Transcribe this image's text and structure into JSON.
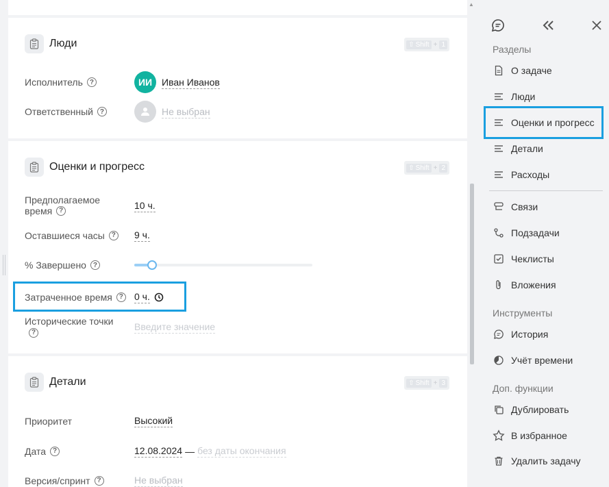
{
  "people": {
    "title": "Люди",
    "hotkey": {
      "shift": "Shift",
      "plus": "+",
      "num": "1"
    },
    "assignee_label": "Исполнитель",
    "assignee_initials": "ИИ",
    "assignee_name": "Иван Иванов",
    "responsible_label": "Ответственный",
    "responsible_value": "Не выбран"
  },
  "estimates": {
    "title": "Оценки и прогресс",
    "hotkey": {
      "shift": "Shift",
      "plus": "+",
      "num": "2"
    },
    "estimated_label_1": "Предполагаемое",
    "estimated_label_2": "время",
    "estimated_value": "10 ч.",
    "remaining_label": "Оставшиеся часы",
    "remaining_value": "9 ч.",
    "percent_label": "% Завершено",
    "percent_value": 0.1,
    "spent_label": "Затраченное время",
    "spent_value": "0 ч.",
    "historical_label": "Исторические точки",
    "historical_placeholder": "Введите значение"
  },
  "details": {
    "title": "Детали",
    "hotkey": {
      "shift": "Shift",
      "plus": "+",
      "num": "3"
    },
    "priority_label": "Приоритет",
    "priority_value": "Высокий",
    "date_label": "Дата",
    "date_start": "12.08.2024",
    "date_dash": "—",
    "date_end": "без даты окончания",
    "version_label": "Версия/спринт",
    "version_value": "Не выбран"
  },
  "sidebar": {
    "sections_title": "Разделы",
    "sections": [
      {
        "label": "О задаче",
        "icon": "document-icon"
      },
      {
        "label": "Люди",
        "icon": "lines-icon"
      },
      {
        "label": "Оценки и прогресс",
        "icon": "lines-icon"
      },
      {
        "label": "Детали",
        "icon": "lines-icon"
      },
      {
        "label": "Расходы",
        "icon": "lines-icon"
      }
    ],
    "links": [
      {
        "label": "Связи",
        "icon": "links-icon"
      },
      {
        "label": "Подзадачи",
        "icon": "subtasks-icon"
      },
      {
        "label": "Чеклисты",
        "icon": "checklist-icon"
      },
      {
        "label": "Вложения",
        "icon": "paperclip-icon"
      }
    ],
    "tools_title": "Инструменты",
    "tools": [
      {
        "label": "История",
        "icon": "history-icon"
      },
      {
        "label": "Учёт времени",
        "icon": "time-tracking-icon"
      }
    ],
    "extra_title": "Доп. функции",
    "extra": [
      {
        "label": "Дублировать",
        "icon": "duplicate-icon"
      },
      {
        "label": "В избранное",
        "icon": "star-icon"
      },
      {
        "label": "Удалить задачу",
        "icon": "trash-icon"
      }
    ]
  },
  "colors": {
    "accent": "#1a9fe0",
    "teal": "#12b3a0"
  }
}
